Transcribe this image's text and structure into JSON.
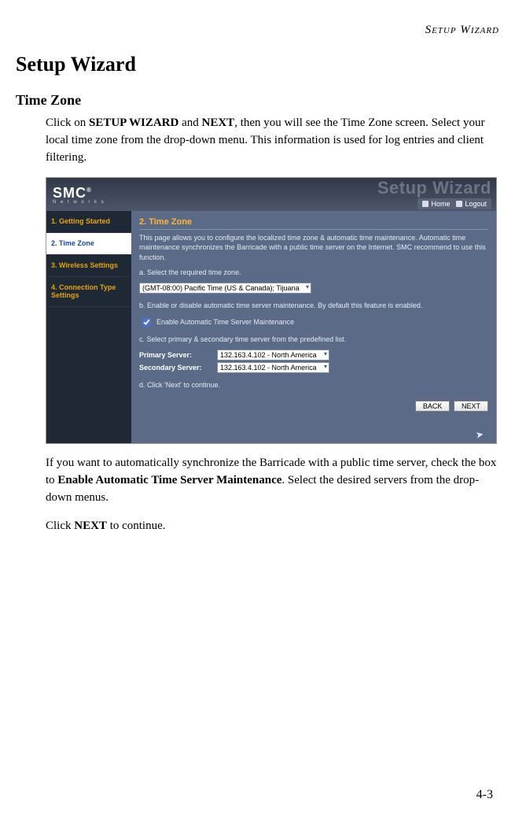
{
  "runningHeader": "Setup Wizard",
  "h1": "Setup Wizard",
  "h2": "Time Zone",
  "para1_pre": "Click on ",
  "para1_b1": "SETUP WIZARD",
  "para1_mid1": " and ",
  "para1_b2": "NEXT",
  "para1_post": ", then you will see the Time Zone screen. Select your local time zone from the drop-down menu. This information is used for log entries and client filtering.",
  "para2_pre": "If you want to automatically synchronize the Barricade with a public time server, check the box to ",
  "para2_b": "Enable Automatic Time Server Maintenance",
  "para2_post": ". Select the desired servers from the drop-down menus.",
  "para3_pre": "Click ",
  "para3_b": "NEXT",
  "para3_post": " to continue.",
  "pageNumber": "4-3",
  "screenshot": {
    "logoBig": "SMC",
    "logoReg": "®",
    "logoSmall": "N e t w o r k s",
    "wizTitle": "Setup Wizard",
    "homeLink": "Home",
    "logoutLink": "Logout",
    "side": {
      "s1": "1. Getting Started",
      "s2": "2. Time Zone",
      "s3": "3. Wireless Settings",
      "s4": "4. Connection Type Settings"
    },
    "mainHeading": "2. Time Zone",
    "intro": "This page allows you to configure the localized time zone & automatic time maintenance. Automatic time maintenance synchronizes the Barricade with a public time server on the Internet. SMC recommend to use this function.",
    "stepA": "a. Select the required time zone.",
    "tzValue": "(GMT-08:00) Pacific Time (US & Canada); Tijuana",
    "stepB": "b. Enable or disable automatic time server maintenance. By default this feature is enabled.",
    "chkLabel": "Enable Automatic Time Server Maintenance",
    "stepC": "c. Select primary & secondary time server from the predefined list.",
    "primaryLabel": "Primary Server:",
    "primaryValue": "132.163.4.102 - North America",
    "secondaryLabel": "Secondary Server:",
    "secondaryValue": "132.163.4.102 - North America",
    "stepD": "d. Click 'Next' to continue.",
    "backBtn": "BACK",
    "nextBtn": "NEXT"
  }
}
